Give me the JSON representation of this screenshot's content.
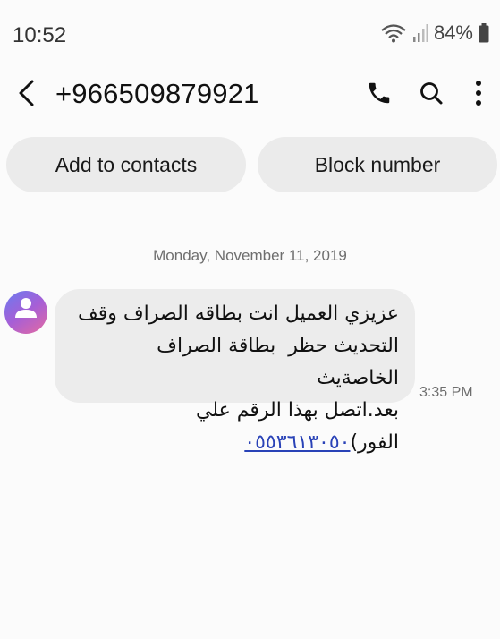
{
  "status_bar": {
    "time": "10:52",
    "battery": "84%",
    "icons": [
      "wifi-icon",
      "signal-icon",
      "battery-icon"
    ]
  },
  "header": {
    "back_icon": "chevron-left-icon",
    "contact_number": "+966509879921",
    "actions": [
      "phone-icon",
      "search-icon",
      "more-vertical-icon"
    ]
  },
  "contact_actions": {
    "add_label": "Add to contacts",
    "block_label": "Block number"
  },
  "conversation": {
    "date": "Monday, November 11, 2019",
    "messages": [
      {
        "avatar_icon": "person-icon",
        "line1": "عزيزي العميل انت بطاقه الصراف وقف",
        "line2": "التحديث حظر  بطاقة الصراف الخاصةيث",
        "line3_text": "بعد.اتصل بهذا الرقم علي الفور)",
        "line3_link": "٠٥٥٣٦١٣٠٥٠",
        "time": "3:35 PM"
      }
    ]
  },
  "colors": {
    "background": "#fbfbfb",
    "bubble": "#ececec",
    "pill": "#ebebeb",
    "link": "#2942b7",
    "avatar_gradient": [
      "#6a7bf0",
      "#a65fd6",
      "#e56aa0"
    ]
  }
}
